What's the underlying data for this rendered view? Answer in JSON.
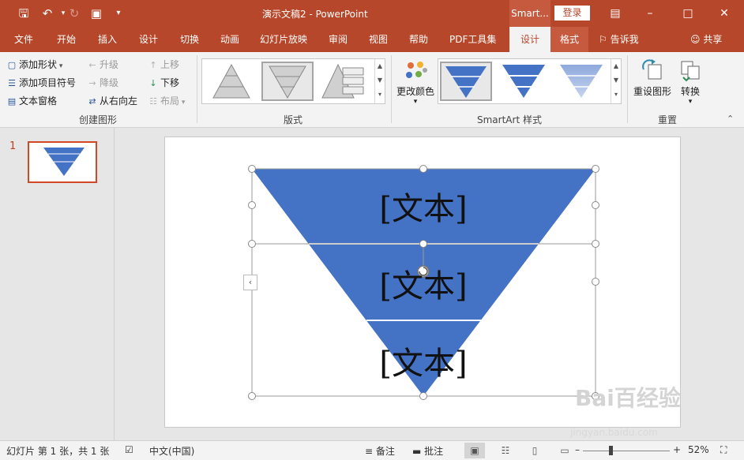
{
  "app": {
    "doc_title": "演示文稿2  -  PowerPoint",
    "context_tab_header": "Smart...",
    "login_label": "登录",
    "brand_color": "#b7472a"
  },
  "quick_access": {
    "icons": [
      "save-icon",
      "undo-icon",
      "redo-icon",
      "slideshow-icon",
      "customize-icon"
    ]
  },
  "tabs": [
    {
      "label": "文件"
    },
    {
      "label": "开始"
    },
    {
      "label": "插入"
    },
    {
      "label": "设计"
    },
    {
      "label": "切换"
    },
    {
      "label": "动画"
    },
    {
      "label": "幻灯片放映"
    },
    {
      "label": "审阅"
    },
    {
      "label": "视图"
    },
    {
      "label": "帮助"
    },
    {
      "label": "PDF工具集"
    },
    {
      "label": "设计"
    },
    {
      "label": "格式"
    }
  ],
  "tell_me": "告诉我",
  "share": "共享",
  "ribbon": {
    "create_graphic": {
      "group_label": "创建图形",
      "add_shape": "添加形状",
      "add_bullet": "添加项目符号",
      "text_pane": "文本窗格",
      "promote": "升级",
      "demote": "降级",
      "right_to_left": "从右向左",
      "move_up": "上移",
      "move_down": "下移",
      "layout": "布局"
    },
    "layouts": {
      "group_label": "版式"
    },
    "smartart_styles": {
      "group_label": "SmartArt 样式",
      "change_colors": "更改颜色"
    },
    "reset": {
      "group_label": "重置",
      "reset_graphic": "重设图形",
      "convert": "转换"
    }
  },
  "slide_panel": {
    "slide_number": "1"
  },
  "slide": {
    "funnel_color": "#4472c4",
    "texts": [
      "[文本]",
      "[文本]",
      "[文本]"
    ]
  },
  "statusbar": {
    "slide_info": "幻灯片 第 1 张，共 1 张",
    "language": "中文(中国)",
    "notes": "备注",
    "comments": "批注",
    "zoom": "52%"
  },
  "watermark": {
    "brand": "Bai百经验",
    "url": "jingyan.baidu.com"
  }
}
